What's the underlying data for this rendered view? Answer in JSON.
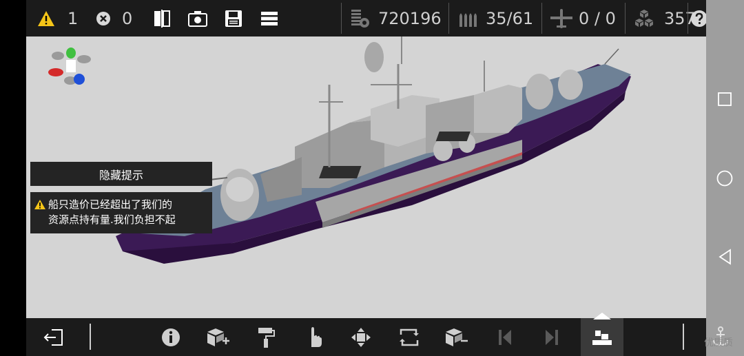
{
  "topbar": {
    "warnings_count": "1",
    "errors_count": "0",
    "tonnage": "720196",
    "ammo": "35/61",
    "aircraft": "0 / 0",
    "resources": "357"
  },
  "hint": {
    "hide_button_label": "隐藏提示",
    "warning_line1": "船只造价已经超出了我们的",
    "warning_line2": "资源点持有量.我们负担不起"
  },
  "icons": {
    "warning": "warning-triangle-icon",
    "error": "close-circle-icon",
    "help": "help-icon"
  },
  "colors": {
    "warning_yellow": "#f5c518",
    "hull_purple": "#3b1a55",
    "deck_blue": "#6e8196",
    "superstructure_gray": "#a8a8a8",
    "viewport_bg": "#d4d4d4",
    "bar_bg": "#1b1b1b"
  },
  "watermark": "优质质"
}
